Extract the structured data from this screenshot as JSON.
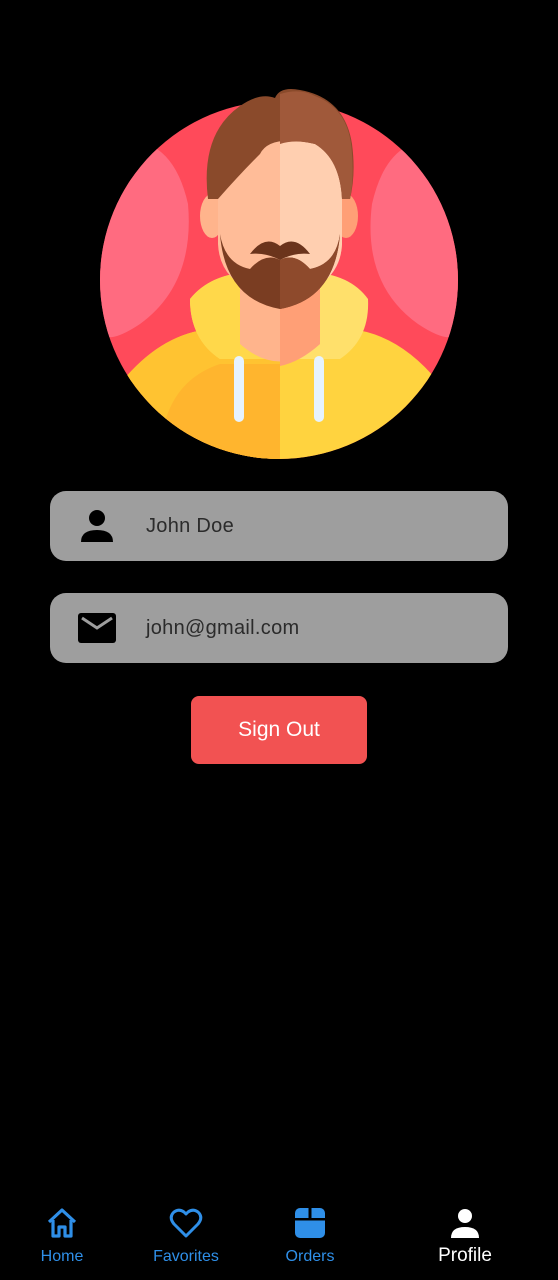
{
  "profile": {
    "avatar_icon": "person-avatar-illustration",
    "name": "John Doe",
    "email": "john@gmail.com",
    "name_icon": "person-icon",
    "email_icon": "mail-icon"
  },
  "actions": {
    "sign_out_label": "Sign Out",
    "sign_out_color": "#f25252"
  },
  "bottom_nav": {
    "items": [
      {
        "label": "Home",
        "icon": "home-icon",
        "active": false
      },
      {
        "label": "Favorites",
        "icon": "heart-icon",
        "active": false
      },
      {
        "label": "Orders",
        "icon": "package-icon",
        "active": false
      },
      {
        "label": "Profile",
        "icon": "person-icon",
        "active": true
      }
    ],
    "accent_color": "#2f8fe8",
    "active_color": "#ffffff"
  }
}
